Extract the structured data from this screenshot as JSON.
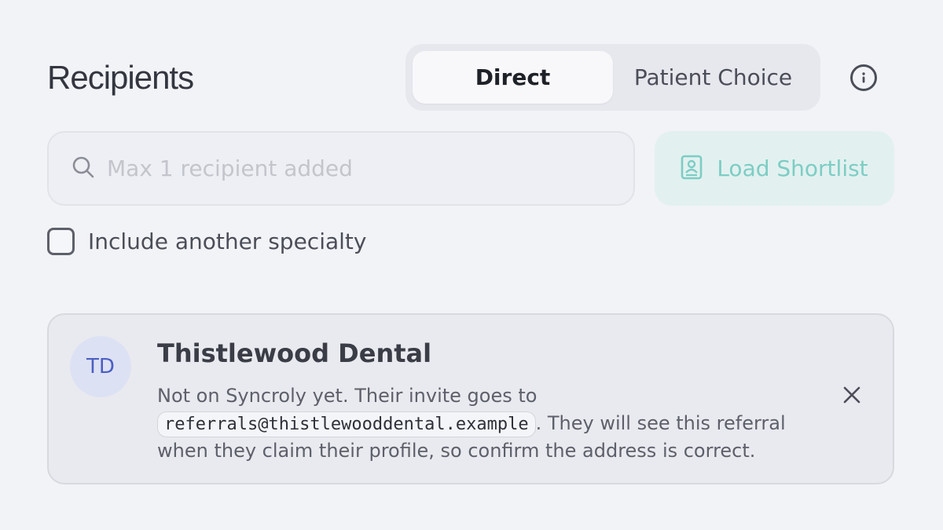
{
  "header": {
    "title": "Recipients",
    "mode_tabs": [
      {
        "label": "Direct",
        "selected": true
      },
      {
        "label": "Patient Choice",
        "selected": false
      }
    ],
    "info_icon": "info-icon"
  },
  "search": {
    "placeholder": "Max 1 recipient added",
    "value": "",
    "icon": "search-icon"
  },
  "shortlist_button": {
    "label": "Load Shortlist",
    "icon": "contact-book-icon"
  },
  "specialty_option": {
    "label": "Include another specialty",
    "checked": false
  },
  "recipient_card": {
    "initials": "TD",
    "name": "Thistlewood Dental",
    "message_before": "Not on Syncroly yet. Their invite goes to",
    "email": "referrals@thistlewooddental.example",
    "message_after": ". They will see this referral when they claim their profile, so confirm the address is correct.",
    "remove_icon": "close-icon"
  },
  "colors": {
    "background": "#f2f3f7",
    "accent_teal": "#7dcdc4",
    "avatar_blue": "#4b5fc2"
  }
}
